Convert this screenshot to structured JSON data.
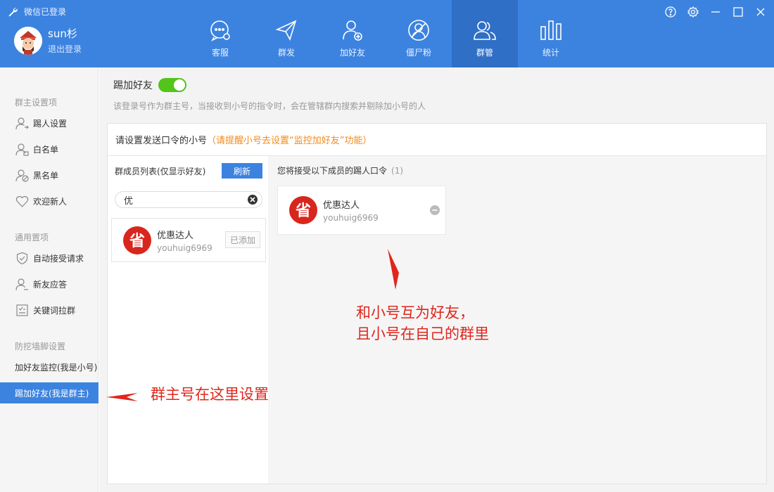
{
  "app": {
    "status": "微信已登录"
  },
  "user": {
    "name": "sun杉",
    "logout": "退出登录"
  },
  "nav": [
    {
      "label": "客服",
      "icon": "chat-icon"
    },
    {
      "label": "群发",
      "icon": "send-icon"
    },
    {
      "label": "加好友",
      "icon": "add-friend-icon"
    },
    {
      "label": "僵尸粉",
      "icon": "zombie-icon"
    },
    {
      "label": "群管",
      "icon": "group-icon",
      "active": true
    },
    {
      "label": "统计",
      "icon": "stats-icon"
    }
  ],
  "sidebar": {
    "section1": "群主设置项",
    "section2": "通用置项",
    "section3": "防挖墙脚设置",
    "items": [
      {
        "label": "踢人设置"
      },
      {
        "label": "白名单"
      },
      {
        "label": "黑名单"
      },
      {
        "label": "欢迎新人"
      },
      {
        "label": "自动接受请求"
      },
      {
        "label": "新友应答"
      },
      {
        "label": "关键词拉群"
      },
      {
        "label": "加好友监控(我是小号)"
      },
      {
        "label": "踢加好友(我是群主)",
        "active": true
      }
    ]
  },
  "main": {
    "toggle_title": "踢加好友",
    "toggle_on": true,
    "description": "该登录号作为群主号，当接收到小号的指令时，会在管辖群内搜索并剔除加小号的人",
    "panel_title": "请设置发送口令的小号",
    "panel_hint": "（请提醒小号去设置“监控加好友”功能）",
    "left": {
      "list_title": "群成员列表(仅显示好友)",
      "refresh": "刷新",
      "search_value": "优",
      "member": {
        "name": "优惠达人",
        "id": "youhuig6969",
        "status": "已添加"
      }
    },
    "right": {
      "title": "您将接受以下成员的踢人口令",
      "count": "(1)",
      "member": {
        "name": "优惠达人",
        "id": "youhuig6969"
      }
    }
  },
  "annotations": {
    "note1_line1": "和小号互为好友，",
    "note1_line2": "且小号在自己的群里",
    "note2": "群主号在这里设置"
  },
  "colors": {
    "header": "#3c83e0",
    "active_nav": "#2f6fc6",
    "toggle": "#52c41a",
    "hint": "#f08b1c",
    "annotation": "#e0261c"
  }
}
